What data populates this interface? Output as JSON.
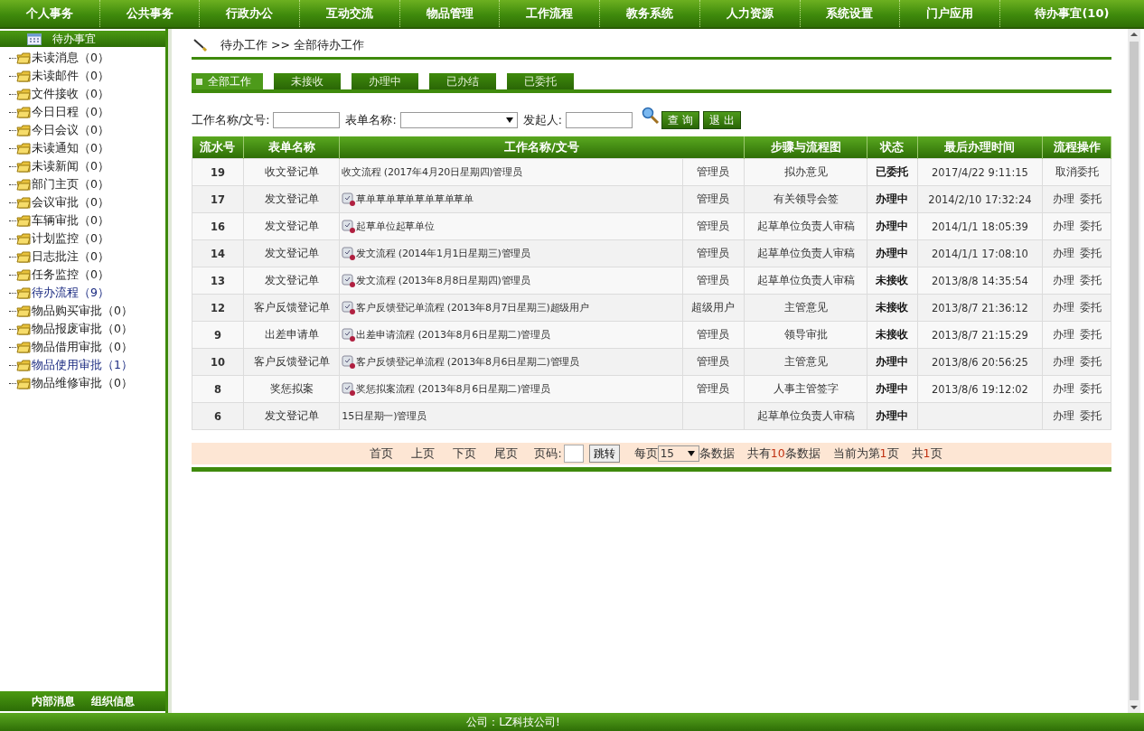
{
  "top_nav": [
    {
      "label": "个人事务",
      "selected": false
    },
    {
      "label": "公共事务",
      "selected": false
    },
    {
      "label": "行政办公",
      "selected": false
    },
    {
      "label": "互动交流",
      "selected": false
    },
    {
      "label": "物品管理",
      "selected": false
    },
    {
      "label": "工作流程",
      "selected": false
    },
    {
      "label": "教务系统",
      "selected": false
    },
    {
      "label": "人力资源",
      "selected": false
    },
    {
      "label": "系统设置",
      "selected": false
    },
    {
      "label": "门户应用",
      "selected": false
    },
    {
      "label": "待办事宜(10)",
      "selected": false
    }
  ],
  "sidebar": {
    "title": "待办事宜",
    "items": [
      {
        "label": "未读消息（0）",
        "highlighted": false
      },
      {
        "label": "未读邮件（0）",
        "highlighted": false
      },
      {
        "label": "文件接收（0）",
        "highlighted": false
      },
      {
        "label": "今日日程（0）",
        "highlighted": false
      },
      {
        "label": "今日会议（0）",
        "highlighted": false
      },
      {
        "label": "未读通知（0）",
        "highlighted": false
      },
      {
        "label": "未读新闻（0）",
        "highlighted": false
      },
      {
        "label": "部门主页（0）",
        "highlighted": false
      },
      {
        "label": "会议审批（0）",
        "highlighted": false
      },
      {
        "label": "车辆审批（0）",
        "highlighted": false
      },
      {
        "label": "计划监控（0）",
        "highlighted": false
      },
      {
        "label": "日志批注（0）",
        "highlighted": false
      },
      {
        "label": "任务监控（0）",
        "highlighted": false
      },
      {
        "label": "待办流程（9）",
        "highlighted": true
      },
      {
        "label": "物品购买审批（0）",
        "highlighted": false
      },
      {
        "label": "物品报废审批（0）",
        "highlighted": false
      },
      {
        "label": "物品借用审批（0）",
        "highlighted": false
      },
      {
        "label": "物品使用审批（1）",
        "highlighted": true
      },
      {
        "label": "物品维修审批（0）",
        "highlighted": false
      }
    ],
    "bottom_tabs": [
      "内部消息",
      "组织信息"
    ]
  },
  "breadcrumb": {
    "parent": "待办工作",
    "separator": ">>",
    "current": "全部待办工作"
  },
  "tabs": [
    {
      "label": "全部工作",
      "selected": true
    },
    {
      "label": "未接收",
      "selected": false
    },
    {
      "label": "办理中",
      "selected": false
    },
    {
      "label": "已办结",
      "selected": false
    },
    {
      "label": "已委托",
      "selected": false
    }
  ],
  "filters": {
    "name_label": "工作名称/文号:",
    "form_label": "表单名称:",
    "starter_label": "发起人:",
    "search_button": "查 询",
    "exit_button": "退 出"
  },
  "table": {
    "columns": [
      "流水号",
      "表单名称",
      "工作名称/文号",
      "步骤与流程图",
      "状态",
      "最后办理时间",
      "流程操作"
    ],
    "rows": [
      {
        "id": "19",
        "form": "收文登记单",
        "name": "收文流程 (2017年4月20日星期四)管理员",
        "has_icon": false,
        "handler": "管理员",
        "step": "拟办意见",
        "status": "已委托",
        "time": "2017/4/22 9:11:15",
        "actions": [
          "取消委托"
        ]
      },
      {
        "id": "17",
        "form": "发文登记单",
        "name": "草单草单草单草单草单草单",
        "has_icon": true,
        "handler": "管理员",
        "step": "有关领导会签",
        "status": "办理中",
        "time": "2014/2/10 17:32:24",
        "actions": [
          "办理",
          "委托"
        ]
      },
      {
        "id": "16",
        "form": "发文登记单",
        "name": "起草单位起草单位",
        "has_icon": true,
        "handler": "管理员",
        "step": "起草单位负责人审稿",
        "status": "办理中",
        "time": "2014/1/1 18:05:39",
        "actions": [
          "办理",
          "委托"
        ]
      },
      {
        "id": "14",
        "form": "发文登记单",
        "name": "发文流程 (2014年1月1日星期三)管理员",
        "has_icon": true,
        "handler": "管理员",
        "step": "起草单位负责人审稿",
        "status": "办理中",
        "time": "2014/1/1 17:08:10",
        "actions": [
          "办理",
          "委托"
        ]
      },
      {
        "id": "13",
        "form": "发文登记单",
        "name": "发文流程 (2013年8月8日星期四)管理员",
        "has_icon": true,
        "handler": "管理员",
        "step": "起草单位负责人审稿",
        "status": "未接收",
        "time": "2013/8/8 14:35:54",
        "actions": [
          "办理",
          "委托"
        ]
      },
      {
        "id": "12",
        "form": "客户反馈登记单",
        "name": "客户反馈登记单流程 (2013年8月7日星期三)超级用户",
        "has_icon": true,
        "handler": "超级用户",
        "step": "主管意见",
        "status": "未接收",
        "time": "2013/8/7 21:36:12",
        "actions": [
          "办理",
          "委托"
        ]
      },
      {
        "id": "9",
        "form": "出差申请单",
        "name": "出差申请流程 (2013年8月6日星期二)管理员",
        "has_icon": true,
        "handler": "管理员",
        "step": "领导审批",
        "status": "未接收",
        "time": "2013/8/7 21:15:29",
        "actions": [
          "办理",
          "委托"
        ]
      },
      {
        "id": "10",
        "form": "客户反馈登记单",
        "name": "客户反馈登记单流程 (2013年8月6日星期二)管理员",
        "has_icon": true,
        "handler": "管理员",
        "step": "主管意见",
        "status": "办理中",
        "time": "2013/8/6 20:56:25",
        "actions": [
          "办理",
          "委托"
        ]
      },
      {
        "id": "8",
        "form": "奖惩拟案",
        "name": "奖惩拟案流程 (2013年8月6日星期二)管理员",
        "has_icon": true,
        "handler": "管理员",
        "step": "人事主管签字",
        "status": "办理中",
        "time": "2013/8/6 19:12:02",
        "actions": [
          "办理",
          "委托"
        ]
      },
      {
        "id": "6",
        "form": "发文登记单",
        "name": "15日星期一)管理员",
        "has_icon": false,
        "step": "起草单位负责人审稿",
        "status": "办理中",
        "actions": [
          "办理",
          "委托"
        ]
      }
    ]
  },
  "pager": {
    "links": [
      "首页",
      "上页",
      "下页",
      "尾页"
    ],
    "page_label": "页码:",
    "go_button": "跳转",
    "per_page_label": "每页",
    "per_page": "15",
    "per_page_suffix": "条数据",
    "counts": [
      {
        "prefix": "共有",
        "value": "10",
        "suffix": "条数据"
      },
      {
        "prefix": "当前为第",
        "value": "1",
        "suffix": "页"
      },
      {
        "prefix": "共",
        "value": "1",
        "suffix": "页"
      }
    ]
  },
  "footer": "公司：LZ科技公司!"
}
